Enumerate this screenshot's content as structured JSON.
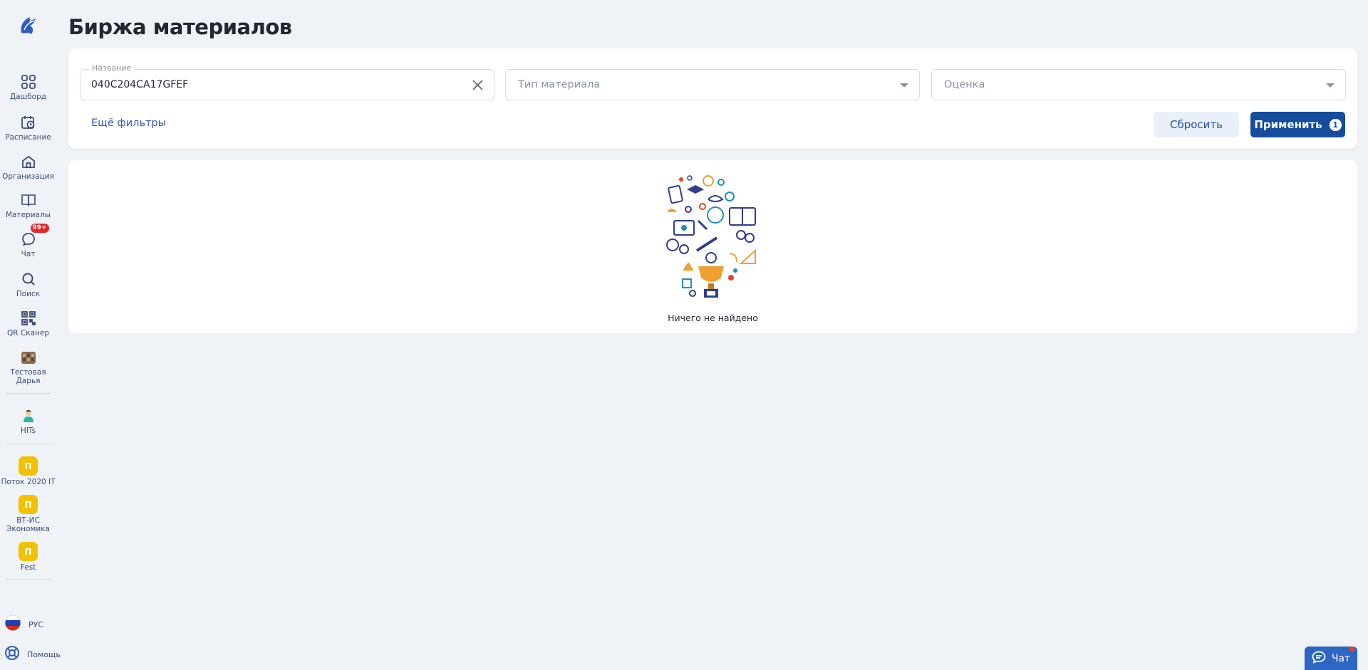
{
  "page": {
    "title": "Биржа материалов"
  },
  "sidebar": {
    "items": [
      {
        "label": "Дашборд",
        "icon": "dashboard-icon"
      },
      {
        "label": "Расписание",
        "icon": "schedule-icon"
      },
      {
        "label": "Организация",
        "icon": "organization-icon"
      },
      {
        "label": "Материалы",
        "icon": "book-icon"
      },
      {
        "label": "Чат",
        "icon": "chat-icon",
        "badge": "99+"
      },
      {
        "label": "Поиск",
        "icon": "search-icon"
      },
      {
        "label": "QR Сканер",
        "icon": "qr-icon"
      },
      {
        "label": "Тестовая Дарья",
        "icon": "org-avatar-icon"
      },
      {
        "label": "HITs",
        "icon": "hits-icon"
      },
      {
        "label": "Поток 2020 IT",
        "icon_letter": "П"
      },
      {
        "label": "ВТ-ИС Экономика",
        "icon_letter": "П"
      },
      {
        "label": "Fest",
        "icon_letter": "П"
      }
    ],
    "language": "РУС",
    "help": "Помощь"
  },
  "filters": {
    "name_legend": "Название",
    "name_value": "040C204CA17GFEF",
    "type_placeholder": "Тип материала",
    "rating_placeholder": "Оценка",
    "more_filters": "Ещё фильтры",
    "reset_label": "Сбросить",
    "apply_label": "Применить",
    "apply_count": "1"
  },
  "results": {
    "empty_text": "Ничего не найдено"
  },
  "chat_widget": {
    "label": "Чат"
  },
  "colors": {
    "primary": "#154c9c",
    "accent_link": "#2f5bbe",
    "badge_red": "#e4262a",
    "stream_yellow": "#f2c200",
    "background": "#eff3f7"
  }
}
